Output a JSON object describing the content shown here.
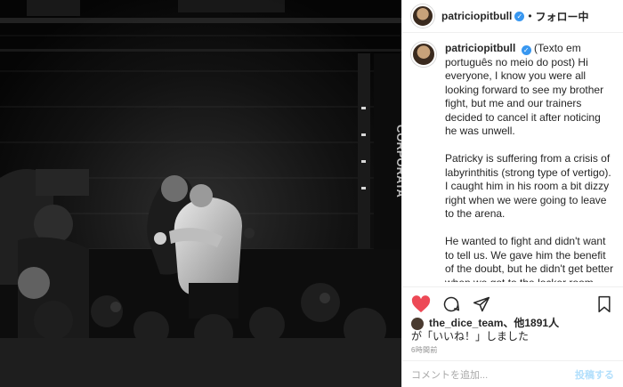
{
  "header": {
    "username": "patriciopitbull",
    "dot": "•",
    "follow_label": "フォロー中",
    "more": "•••"
  },
  "caption": {
    "username": "patriciopitbull",
    "paragraphs": [
      "(Texto em português no meio do post) Hi everyone, I know you were all looking forward to see my brother fight, but me and our trainers decided to cancel it after noticing he was unwell.",
      "Patricky is suffering from a crisis of labyrinthitis (strong type of vertigo). I caught him in his room a bit dizzy right when we were going to leave to the arena.",
      "He wanted to fight and didn't want to tell us. We gave him the benefit of the doubt, but he didn't get better when we got to the locker room and we cancelled the fight."
    ]
  },
  "likes": {
    "user": "the_dice_team",
    "others": "、他1891人",
    "suffix": "が「いいね！」しました"
  },
  "timestamp": "6時間前",
  "comment": {
    "placeholder": "コメントを追加...",
    "post_label": "投稿する"
  },
  "photo": {
    "banner_text": "CORPORATA"
  },
  "colors": {
    "heart": "#ed4956",
    "verified": "#3897f0",
    "post_disabled": "#b2dffc"
  }
}
